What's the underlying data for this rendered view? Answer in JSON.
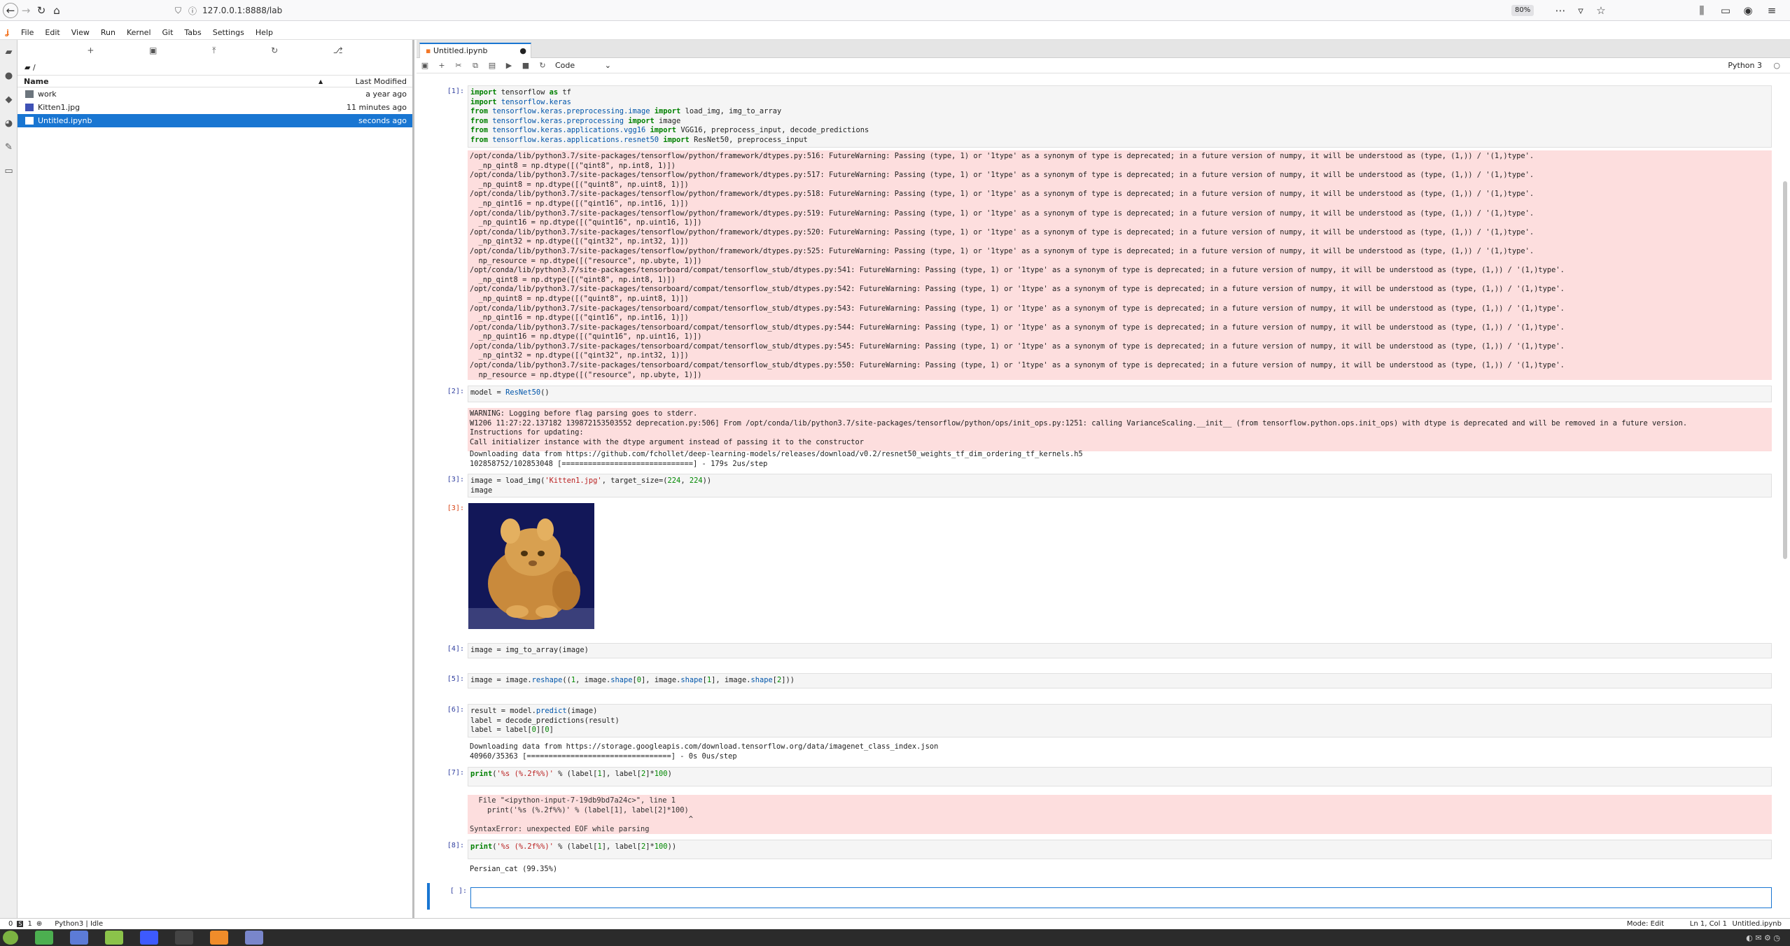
{
  "browser": {
    "url": "127.0.0.1:8888/lab",
    "zoom": "80%"
  },
  "menu": [
    "File",
    "Edit",
    "View",
    "Run",
    "Kernel",
    "Git",
    "Tabs",
    "Settings",
    "Help"
  ],
  "filebrowser": {
    "path": "/",
    "col_name": "Name",
    "col_modified": "Last Modified",
    "files": [
      {
        "name": "work",
        "modified": "a year ago",
        "icon": "folder-icon"
      },
      {
        "name": "Kitten1.jpg",
        "modified": "11 minutes ago",
        "icon": "image-file-icon"
      },
      {
        "name": "Untitled.ipynb",
        "modified": "seconds ago",
        "icon": "notebook-icon"
      }
    ]
  },
  "notebook": {
    "tab_title": "Untitled.ipynb",
    "cell_type": "Code",
    "kernel": "Python 3"
  },
  "cells": {
    "c1_prompt": "[1]:",
    "c1_code": [
      "import tensorflow as tf",
      "import tensorflow.keras",
      "from tensorflow.keras.preprocessing.image import load_img, img_to_array",
      "from tensorflow.keras.preprocessing import image",
      "from tensorflow.keras.applications.vgg16 import VGG16, preprocess_input, decode_predictions",
      "from tensorflow.keras.applications.resnet50 import ResNet50, preprocess_input"
    ],
    "c1_stderr": "/opt/conda/lib/python3.7/site-packages/tensorflow/python/framework/dtypes.py:516: FutureWarning: Passing (type, 1) or '1type' as a synonym of type is deprecated; in a future version of numpy, it will be understood as (type, (1,)) / '(1,)type'.\n  _np_qint8 = np.dtype([(\"qint8\", np.int8, 1)])\n/opt/conda/lib/python3.7/site-packages/tensorflow/python/framework/dtypes.py:517: FutureWarning: Passing (type, 1) or '1type' as a synonym of type is deprecated; in a future version of numpy, it will be understood as (type, (1,)) / '(1,)type'.\n  _np_quint8 = np.dtype([(\"quint8\", np.uint8, 1)])\n/opt/conda/lib/python3.7/site-packages/tensorflow/python/framework/dtypes.py:518: FutureWarning: Passing (type, 1) or '1type' as a synonym of type is deprecated; in a future version of numpy, it will be understood as (type, (1,)) / '(1,)type'.\n  _np_qint16 = np.dtype([(\"qint16\", np.int16, 1)])\n/opt/conda/lib/python3.7/site-packages/tensorflow/python/framework/dtypes.py:519: FutureWarning: Passing (type, 1) or '1type' as a synonym of type is deprecated; in a future version of numpy, it will be understood as (type, (1,)) / '(1,)type'.\n  _np_quint16 = np.dtype([(\"quint16\", np.uint16, 1)])\n/opt/conda/lib/python3.7/site-packages/tensorflow/python/framework/dtypes.py:520: FutureWarning: Passing (type, 1) or '1type' as a synonym of type is deprecated; in a future version of numpy, it will be understood as (type, (1,)) / '(1,)type'.\n  _np_qint32 = np.dtype([(\"qint32\", np.int32, 1)])\n/opt/conda/lib/python3.7/site-packages/tensorflow/python/framework/dtypes.py:525: FutureWarning: Passing (type, 1) or '1type' as a synonym of type is deprecated; in a future version of numpy, it will be understood as (type, (1,)) / '(1,)type'.\n  np_resource = np.dtype([(\"resource\", np.ubyte, 1)])\n/opt/conda/lib/python3.7/site-packages/tensorboard/compat/tensorflow_stub/dtypes.py:541: FutureWarning: Passing (type, 1) or '1type' as a synonym of type is deprecated; in a future version of numpy, it will be understood as (type, (1,)) / '(1,)type'.\n  _np_qint8 = np.dtype([(\"qint8\", np.int8, 1)])\n/opt/conda/lib/python3.7/site-packages/tensorboard/compat/tensorflow_stub/dtypes.py:542: FutureWarning: Passing (type, 1) or '1type' as a synonym of type is deprecated; in a future version of numpy, it will be understood as (type, (1,)) / '(1,)type'.\n  _np_quint8 = np.dtype([(\"quint8\", np.uint8, 1)])\n/opt/conda/lib/python3.7/site-packages/tensorboard/compat/tensorflow_stub/dtypes.py:543: FutureWarning: Passing (type, 1) or '1type' as a synonym of type is deprecated; in a future version of numpy, it will be understood as (type, (1,)) / '(1,)type'.\n  _np_qint16 = np.dtype([(\"qint16\", np.int16, 1)])\n/opt/conda/lib/python3.7/site-packages/tensorboard/compat/tensorflow_stub/dtypes.py:544: FutureWarning: Passing (type, 1) or '1type' as a synonym of type is deprecated; in a future version of numpy, it will be understood as (type, (1,)) / '(1,)type'.\n  _np_quint16 = np.dtype([(\"quint16\", np.uint16, 1)])\n/opt/conda/lib/python3.7/site-packages/tensorboard/compat/tensorflow_stub/dtypes.py:545: FutureWarning: Passing (type, 1) or '1type' as a synonym of type is deprecated; in a future version of numpy, it will be understood as (type, (1,)) / '(1,)type'.\n  _np_qint32 = np.dtype([(\"qint32\", np.int32, 1)])\n/opt/conda/lib/python3.7/site-packages/tensorboard/compat/tensorflow_stub/dtypes.py:550: FutureWarning: Passing (type, 1) or '1type' as a synonym of type is deprecated; in a future version of numpy, it will be understood as (type, (1,)) / '(1,)type'.\n  np_resource = np.dtype([(\"resource\", np.ubyte, 1)])",
    "c2_prompt": "[2]:",
    "c2_code": "model = ResNet50()",
    "c2_stderr": "WARNING: Logging before flag parsing goes to stderr.\nW1206 11:27:22.137182 139872153503552 deprecation.py:506] From /opt/conda/lib/python3.7/site-packages/tensorflow/python/ops/init_ops.py:1251: calling VarianceScaling.__init__ (from tensorflow.python.ops.init_ops) with dtype is deprecated and will be removed in a future version.\nInstructions for updating:\nCall initializer instance with the dtype argument instead of passing it to the constructor",
    "c2_stdout": "Downloading data from https://github.com/fchollet/deep-learning-models/releases/download/v0.2/resnet50_weights_tf_dim_ordering_tf_kernels.h5\n102858752/102853048 [==============================] - 179s 2us/step",
    "c3_prompt": "[3]:",
    "c3_code": "image = load_img('Kitten1.jpg', target_size=(224, 224))\nimage",
    "c3_out_prompt": "[3]:",
    "c4_prompt": "[4]:",
    "c4_code": "image = img_to_array(image)",
    "c5_prompt": "[5]:",
    "c5_code": "image = image.reshape((1, image.shape[0], image.shape[1], image.shape[2]))",
    "c6_prompt": "[6]:",
    "c6_code": "result = model.predict(image)\nlabel = decode_predictions(result)\nlabel = label[0][0]",
    "c6_stdout": "Downloading data from https://storage.googleapis.com/download.tensorflow.org/data/imagenet_class_index.json\n40960/35363 [=================================] - 0s 0us/step",
    "c7_prompt": "[7]:",
    "c7_code": "print('%s (%.2f%%)' % (label[1], label[2]*100)",
    "c7_error": "  File \"<ipython-input-7-19db9bd7a24c>\", line 1\n    print('%s (%.2f%%)' % (label[1], label[2]*100)\n                                                  ^\nSyntaxError: unexpected EOF while parsing",
    "c8_prompt": "[8]:",
    "c8_code": "print('%s (%.2f%%)' % (label[1], label[2]*100))",
    "c8_stdout": "Persian_cat (99.35%)",
    "c9_prompt": "[ ]:"
  },
  "status": {
    "left_counts": "0",
    "left_counts2": "1",
    "kernel_status": "Python3 | Idle",
    "mode": "Mode: Edit",
    "cursor": "Ln 1, Col 1",
    "file": "Untitled.ipynb"
  },
  "colors": {
    "accent": "#1976d2",
    "stderr_bg": "#fddede"
  }
}
